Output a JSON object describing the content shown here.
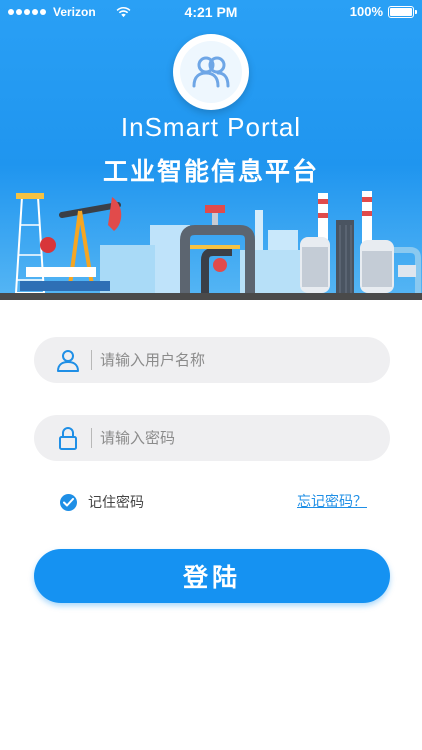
{
  "status_bar": {
    "carrier": "Verizon",
    "time": "4:21 PM",
    "battery": "100%"
  },
  "header": {
    "app_title": "InSmart Portal",
    "app_subtitle": "工业智能信息平台"
  },
  "form": {
    "username_placeholder": "请输入用户名称",
    "password_placeholder": "请输入密码",
    "remember_label": "记住密码",
    "remember_checked": true,
    "forgot_label": "忘记密码？",
    "login_label": "登陆"
  },
  "colors": {
    "hero_blue": "#1f95ef",
    "accent": "#1592f2",
    "field_bg": "#efeff1"
  },
  "icons": {
    "logo": "users-icon",
    "username": "user-icon",
    "password": "lock-icon",
    "remember": "checkmark-icon"
  }
}
